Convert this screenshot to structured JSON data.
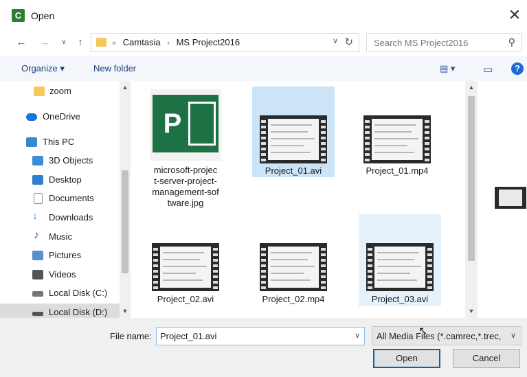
{
  "window": {
    "title": "Open",
    "app_icon_letter": "C"
  },
  "address": {
    "crumbs": [
      "«",
      "Camtasia",
      "›",
      "MS Project2016"
    ]
  },
  "search": {
    "placeholder": "Search MS Project2016"
  },
  "toolbar": {
    "organize": "Organize ▾",
    "new_folder": "New folder"
  },
  "sidebar": {
    "items": [
      {
        "label": "zoom",
        "icon": "folder-icon",
        "color": "#f6c75c"
      },
      {
        "label": "OneDrive",
        "icon": "cloud-icon",
        "color": "#1e73d6"
      },
      {
        "label": "This PC",
        "icon": "computer-icon",
        "color": "#3a85d4"
      },
      {
        "label": "3D Objects",
        "icon": "cube-icon",
        "color": "#3a8ed8"
      },
      {
        "label": "Desktop",
        "icon": "desktop-icon",
        "color": "#2c7fd1"
      },
      {
        "label": "Documents",
        "icon": "document-icon",
        "color": "#8a8a8a"
      },
      {
        "label": "Downloads",
        "icon": "download-icon",
        "color": "#2c7fd1"
      },
      {
        "label": "Music",
        "icon": "music-icon",
        "color": "#1e66c9"
      },
      {
        "label": "Pictures",
        "icon": "picture-icon",
        "color": "#5a8fcf"
      },
      {
        "label": "Videos",
        "icon": "video-icon",
        "color": "#555555"
      },
      {
        "label": "Local Disk (C:)",
        "icon": "drive-icon",
        "color": "#777777"
      },
      {
        "label": "Local Disk (D:)",
        "icon": "drive-icon",
        "color": "#777777"
      }
    ]
  },
  "files": [
    {
      "name": "microsoft-project-server-project-management-software.jpg",
      "lines": [
        "microsoft-projec",
        "t-server-project-",
        "management-sof",
        "tware.jpg"
      ]
    },
    {
      "name": "Project_01.avi"
    },
    {
      "name": "Project_01.mp4"
    },
    {
      "name": "Project_02.avi"
    },
    {
      "name": "Project_02.mp4"
    },
    {
      "name": "Project_03.avi"
    }
  ],
  "footer": {
    "file_name_label": "File name:",
    "file_name_value": "Project_01.avi",
    "filter": "All Media Files (*.camrec,*.trec,",
    "open": "Open",
    "cancel": "Cancel"
  }
}
